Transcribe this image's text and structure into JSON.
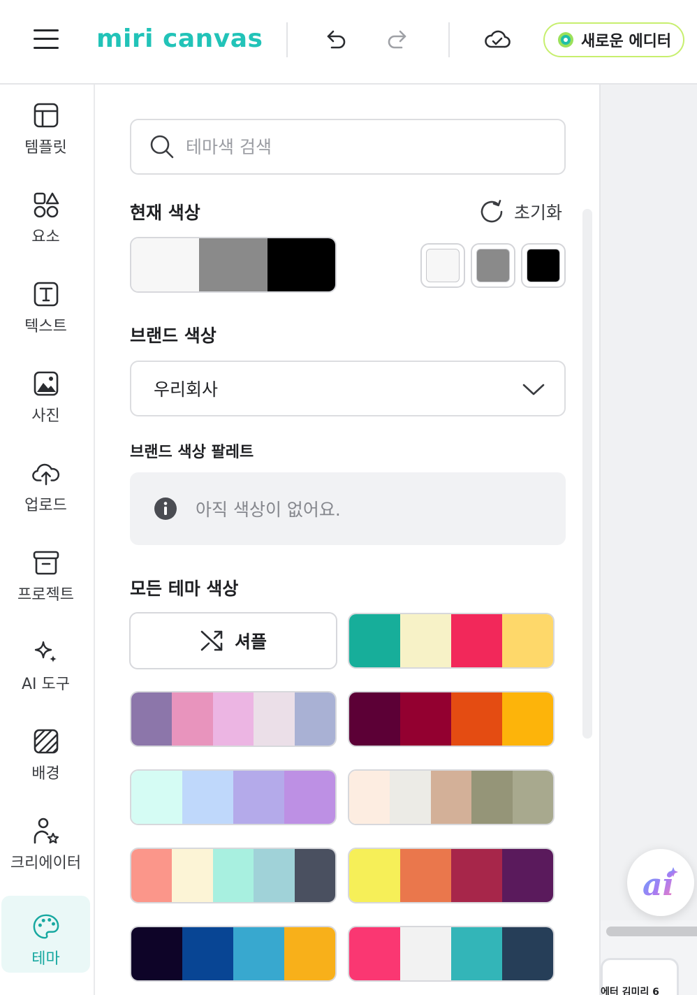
{
  "app": {
    "logo_text": "miri canvas",
    "new_editor_label": "새로운 에디터",
    "accent_color": "#22c3b8"
  },
  "toolbar": {
    "icons": [
      "menu-icon",
      "undo-icon",
      "redo-icon",
      "cloud-saved-icon"
    ]
  },
  "sidebar": {
    "items": [
      {
        "label": "템플릿",
        "icon": "template-icon",
        "active": false
      },
      {
        "label": "요소",
        "icon": "elements-icon",
        "active": false
      },
      {
        "label": "텍스트",
        "icon": "text-icon",
        "active": false
      },
      {
        "label": "사진",
        "icon": "photo-icon",
        "active": false
      },
      {
        "label": "업로드",
        "icon": "upload-icon",
        "active": false
      },
      {
        "label": "프로젝트",
        "icon": "project-icon",
        "active": false
      },
      {
        "label": "AI 도구",
        "icon": "ai-tools-icon",
        "active": false
      },
      {
        "label": "배경",
        "icon": "background-icon",
        "active": false
      },
      {
        "label": "크리에이터",
        "icon": "creator-icon",
        "active": false
      },
      {
        "label": "테마",
        "icon": "theme-palette-icon",
        "active": true
      }
    ]
  },
  "panel": {
    "search": {
      "placeholder": "테마색 검색",
      "value": ""
    },
    "current": {
      "title": "현재 색상",
      "reset_label": "초기화",
      "colors": [
        "#f7f7f7",
        "#8a8a8a",
        "#000000"
      ]
    },
    "brand": {
      "title": "브랜드 색상",
      "selected": "우리회사",
      "palette_title": "브랜드 색상 팔레트",
      "empty_message": "아직 색상이 없어요."
    },
    "themes": {
      "title": "모든 테마 색상",
      "shuffle_label": "셔플",
      "palettes": [
        [
          "#17ae9a",
          "#f7f2c7",
          "#f2285a",
          "#fed86a"
        ],
        [
          "#8c76aa",
          "#e894bd",
          "#ecb5e3",
          "#ebdfe8",
          "#a9b1d4"
        ],
        [
          "#5c0036",
          "#930030",
          "#e44c12",
          "#fdb40a"
        ],
        [
          "#d5fcf4",
          "#bfd8fb",
          "#b4aaea",
          "#bd90e4"
        ],
        [
          "#fdede1",
          "#ecebe6",
          "#d3b098",
          "#959578",
          "#a8a98e"
        ],
        [
          "#fb968a",
          "#fcf4d6",
          "#a8f0e0",
          "#a0d2d8",
          "#4a5060"
        ],
        [
          "#f6ef58",
          "#ea774c",
          "#a7264a",
          "#5a1a5c"
        ],
        [
          "#0e0428",
          "#084594",
          "#38a8cf",
          "#f8b01a"
        ],
        [
          "#fa3772",
          "#f2f2f2",
          "#33b5b8",
          "#263e58"
        ]
      ]
    }
  },
  "canvas": {
    "thumb_text": "에터 김미리 6"
  }
}
